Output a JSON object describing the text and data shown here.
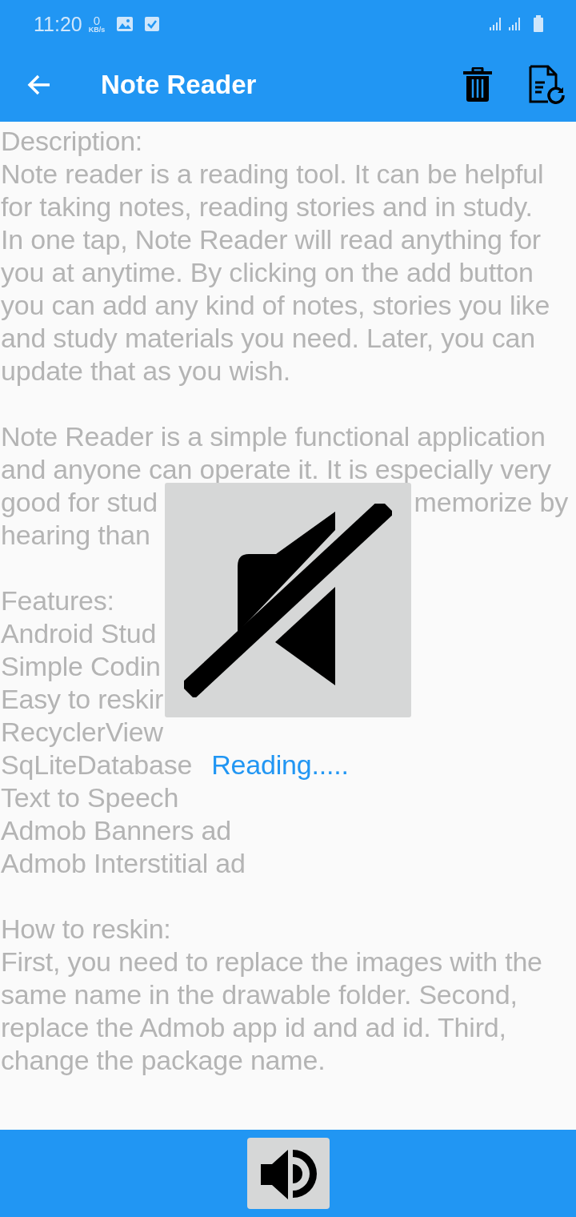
{
  "status_bar": {
    "time": "11:20",
    "net_speed": "0",
    "net_unit": "KB/s"
  },
  "toolbar": {
    "title": "Note Reader"
  },
  "paragraphs": [
    {
      "lines": [
        {
          "text": "Description:"
        },
        {
          "text": "Note reader is a reading tool. It can be helpful"
        },
        {
          "text": "for taking notes, reading stories and in study."
        },
        {
          "text": "In one tap, Note Reader will read anything for"
        },
        {
          "text": "you at anytime. By clicking on the add button"
        },
        {
          "text": "you can add any kind of notes, stories you like"
        },
        {
          "text": "and study materials you need. Later, you can"
        },
        {
          "text": "update that as you wish."
        }
      ]
    },
    {
      "lines": [
        {
          "text": "Note Reader is a simple functional application"
        },
        {
          "text": "and anyone can operate it. It is especially very"
        },
        {
          "text": "good for stud",
          "right": "memorize by"
        },
        {
          "text": "hearing than"
        }
      ]
    },
    {
      "lines": [
        {
          "text": "Features:"
        },
        {
          "text": "Android Stud"
        },
        {
          "text": "Simple Codin"
        },
        {
          "text": "Easy to reskir"
        },
        {
          "text": "RecyclerView"
        },
        {
          "text": "SqLiteDatabase",
          "status": "Reading....."
        },
        {
          "text": "Text to Speech"
        },
        {
          "text": "Admob Banners ad"
        },
        {
          "text": "Admob Interstitial ad"
        }
      ]
    },
    {
      "lines": [
        {
          "text": "How to reskin:"
        },
        {
          "text": "First, you need to replace the images with the"
        },
        {
          "text": "same name in the drawable folder. Second,"
        },
        {
          "text": "replace the Admob app id and ad id. Third,"
        },
        {
          "text": "change the package name."
        }
      ]
    }
  ],
  "mute_dialog": {
    "muted": true
  },
  "bottom_bar": {
    "speaker_muted": false
  }
}
